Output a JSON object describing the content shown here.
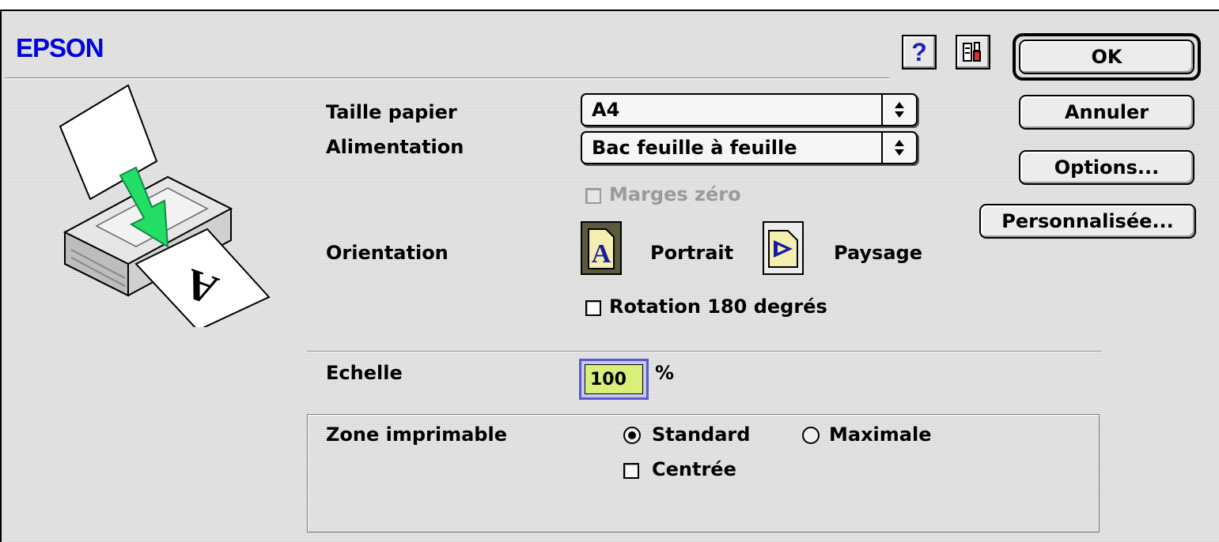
{
  "brand": "EPSON",
  "toolbar": {
    "help_icon": "question-mark-icon",
    "utility_icon": "printer-tools-icon"
  },
  "buttons": {
    "ok": "OK",
    "cancel": "Annuler",
    "options": "Options...",
    "custom": "Personnalisée..."
  },
  "paper_size": {
    "label": "Taille papier",
    "value": "A4"
  },
  "paper_source": {
    "label": "Alimentation",
    "value": "Bac feuille à feuille"
  },
  "zero_margins": {
    "label": "Marges zéro",
    "checked": false,
    "enabled": false
  },
  "orientation": {
    "label": "Orientation",
    "portrait": "Portrait",
    "landscape": "Paysage",
    "selected": "Portrait"
  },
  "rotate180": {
    "label": "Rotation 180 degrés",
    "checked": false
  },
  "scale": {
    "label": "Echelle",
    "value": "100",
    "unit": "%"
  },
  "printable_area": {
    "label": "Zone imprimable",
    "standard": "Standard",
    "maximal": "Maximale",
    "selected": "Standard",
    "centered": {
      "label": "Centrée",
      "checked": false
    }
  },
  "colors": {
    "accent": "#0000e0",
    "field_highlight": "#d8f07a",
    "focus_ring": "#5a5ad0"
  }
}
